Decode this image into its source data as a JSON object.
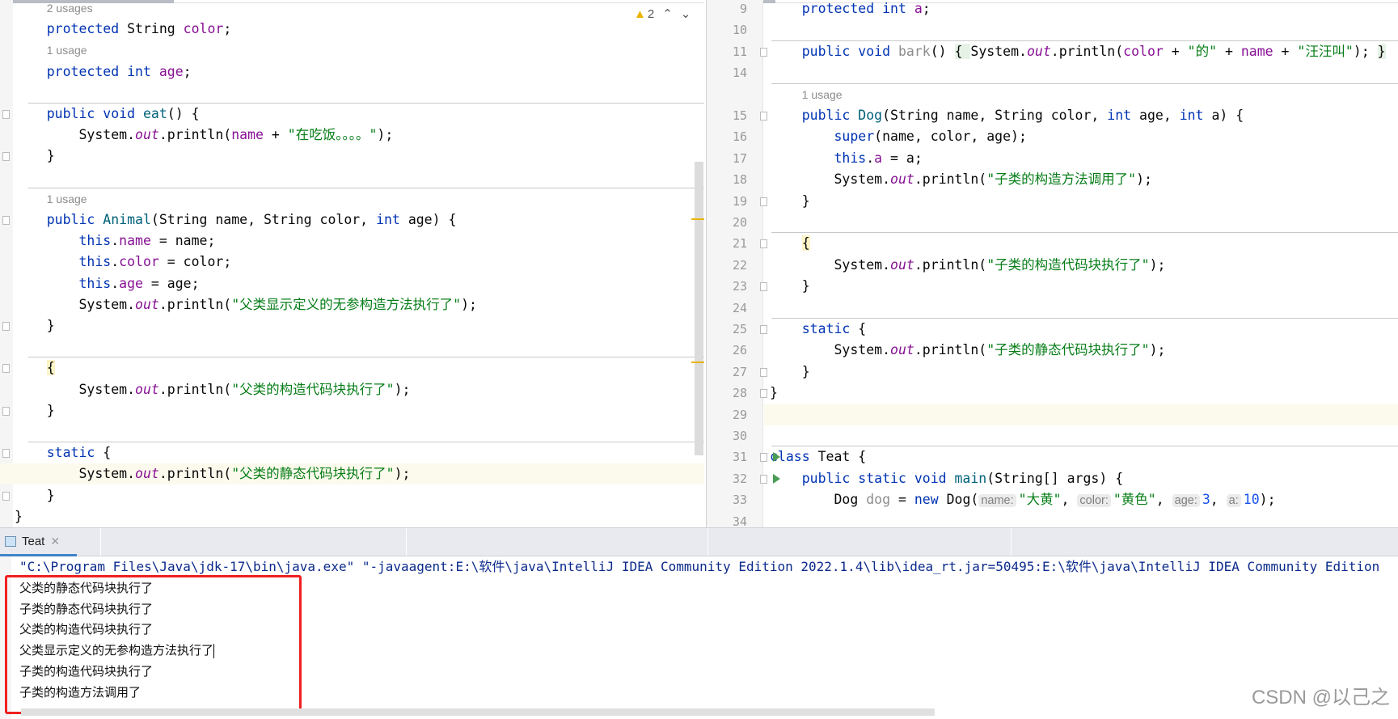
{
  "left_editor": {
    "warning_count": "2",
    "lines": [
      {
        "hint": "2 usages"
      },
      {
        "t": [
          [
            "    "
          ],
          [
            "protected ",
            "kw"
          ],
          [
            "String "
          ],
          [
            "color",
            "fd"
          ],
          [
            ";"
          ]
        ]
      },
      {
        "hint": "1 usage"
      },
      {
        "t": [
          [
            "    "
          ],
          [
            "protected int ",
            "kw"
          ],
          [
            "age",
            "fd"
          ],
          [
            ";"
          ]
        ]
      },
      {
        "t": []
      },
      {
        "t": [
          [
            "    "
          ],
          [
            "public void ",
            "kw"
          ],
          [
            "eat",
            "fn"
          ],
          [
            "() {"
          ]
        ]
      },
      {
        "t": [
          [
            "        System."
          ],
          [
            "out",
            "it"
          ],
          [
            ".println("
          ],
          [
            "name",
            "fd"
          ],
          [
            " + "
          ],
          [
            "\"在吃饭。。。。\"",
            "st"
          ],
          [
            ");"
          ]
        ]
      },
      {
        "t": [
          [
            "    }"
          ]
        ]
      },
      {
        "t": []
      },
      {
        "hint": "1 usage"
      },
      {
        "t": [
          [
            "    "
          ],
          [
            "public ",
            "kw"
          ],
          [
            "Animal",
            "fn"
          ],
          [
            "(String name, String color, "
          ],
          [
            "int ",
            "kw"
          ],
          [
            "age) {"
          ]
        ]
      },
      {
        "t": [
          [
            "        "
          ],
          [
            "this",
            "kw"
          ],
          [
            "."
          ],
          [
            "name",
            "fd"
          ],
          [
            " = name;"
          ]
        ]
      },
      {
        "t": [
          [
            "        "
          ],
          [
            "this",
            "kw"
          ],
          [
            "."
          ],
          [
            "color",
            "fd"
          ],
          [
            " = color;"
          ]
        ]
      },
      {
        "t": [
          [
            "        "
          ],
          [
            "this",
            "kw"
          ],
          [
            "."
          ],
          [
            "age",
            "fd"
          ],
          [
            " = age;"
          ]
        ]
      },
      {
        "t": [
          [
            "        System."
          ],
          [
            "out",
            "it"
          ],
          [
            ".println("
          ],
          [
            "\"父类显示定义的无参构造方法执行了\"",
            "st"
          ],
          [
            ");"
          ]
        ]
      },
      {
        "t": [
          [
            "    }"
          ]
        ]
      },
      {
        "t": []
      },
      {
        "t": [
          [
            "    "
          ],
          [
            "{",
            "mk"
          ]
        ]
      },
      {
        "t": [
          [
            "        System."
          ],
          [
            "out",
            "it"
          ],
          [
            ".println("
          ],
          [
            "\"父类的构造代码块执行了\"",
            "st"
          ],
          [
            ");"
          ]
        ]
      },
      {
        "t": [
          [
            "    }"
          ]
        ]
      },
      {
        "t": []
      },
      {
        "t": [
          [
            "    "
          ],
          [
            "static ",
            "kw"
          ],
          [
            "{"
          ]
        ]
      },
      {
        "t": [
          [
            "        System."
          ],
          [
            "out",
            "it"
          ],
          [
            ".println("
          ],
          [
            "\"父类的静态代码块执行了\"",
            "st"
          ],
          [
            ");"
          ]
        ],
        "current": true
      },
      {
        "t": [
          [
            "    }"
          ]
        ]
      },
      {
        "t": [
          [
            "}"
          ]
        ]
      }
    ]
  },
  "right_editor": {
    "lines": [
      {
        "n": "9",
        "t": [
          [
            "    "
          ],
          [
            "protected int ",
            "kw"
          ],
          [
            "a",
            "fd"
          ],
          [
            ";"
          ]
        ]
      },
      {
        "n": "10",
        "t": []
      },
      {
        "n": "11",
        "t": [
          [
            "    "
          ],
          [
            "public void ",
            "kw"
          ],
          [
            "bark",
            "gr"
          ],
          [
            "() "
          ],
          [
            "{ ",
            "gb"
          ],
          [
            "System."
          ],
          [
            "out",
            "it"
          ],
          [
            ".println("
          ],
          [
            "color",
            "fd"
          ],
          [
            " + "
          ],
          [
            "\"的\"",
            "st"
          ],
          [
            " + "
          ],
          [
            "name",
            "fd"
          ],
          [
            " + "
          ],
          [
            "\"汪汪叫\"",
            "st"
          ],
          [
            "); "
          ],
          [
            "}",
            "gb"
          ]
        ]
      },
      {
        "n": "14",
        "t": []
      },
      {
        "hint": "1 usage"
      },
      {
        "n": "15",
        "t": [
          [
            "    "
          ],
          [
            "public ",
            "kw"
          ],
          [
            "Dog",
            "fn"
          ],
          [
            "(String name, String color, "
          ],
          [
            "int ",
            "kw"
          ],
          [
            "age, "
          ],
          [
            "int ",
            "kw"
          ],
          [
            "a) {"
          ]
        ]
      },
      {
        "n": "16",
        "t": [
          [
            "        "
          ],
          [
            "super",
            "kw"
          ],
          [
            "(name, color, age);"
          ]
        ]
      },
      {
        "n": "17",
        "t": [
          [
            "        "
          ],
          [
            "this",
            "kw"
          ],
          [
            "."
          ],
          [
            "a",
            "fd"
          ],
          [
            " = a;"
          ]
        ]
      },
      {
        "n": "18",
        "t": [
          [
            "        System."
          ],
          [
            "out",
            "it"
          ],
          [
            ".println("
          ],
          [
            "\"子类的构造方法调用了\"",
            "st"
          ],
          [
            ");"
          ]
        ]
      },
      {
        "n": "19",
        "t": [
          [
            "    }"
          ]
        ]
      },
      {
        "n": "20",
        "t": []
      },
      {
        "n": "21",
        "t": [
          [
            "    "
          ],
          [
            "{",
            "mk"
          ]
        ]
      },
      {
        "n": "22",
        "t": [
          [
            "        System."
          ],
          [
            "out",
            "it"
          ],
          [
            ".println("
          ],
          [
            "\"子类的构造代码块执行了\"",
            "st"
          ],
          [
            ");"
          ]
        ]
      },
      {
        "n": "23",
        "t": [
          [
            "    }"
          ]
        ]
      },
      {
        "n": "24",
        "t": []
      },
      {
        "n": "25",
        "t": [
          [
            "    "
          ],
          [
            "static ",
            "kw"
          ],
          [
            "{"
          ]
        ]
      },
      {
        "n": "26",
        "t": [
          [
            "        System."
          ],
          [
            "out",
            "it"
          ],
          [
            ".println("
          ],
          [
            "\"子类的静态代码块执行了\"",
            "st"
          ],
          [
            ");"
          ]
        ]
      },
      {
        "n": "27",
        "t": [
          [
            "    }"
          ]
        ]
      },
      {
        "n": "28",
        "t": [
          [
            "}"
          ]
        ]
      },
      {
        "n": "29",
        "t": [],
        "current": true
      },
      {
        "n": "30",
        "t": []
      },
      {
        "n": "31",
        "run": true,
        "t": [
          [
            "class ",
            "kw"
          ],
          [
            "Teat {"
          ]
        ]
      },
      {
        "n": "32",
        "run": true,
        "t": [
          [
            "    "
          ],
          [
            "public static void ",
            "kw"
          ],
          [
            "main",
            "fn"
          ],
          [
            "(String[] args) {"
          ]
        ]
      },
      {
        "n": "33",
        "t": [
          [
            "        Dog "
          ],
          [
            "dog ",
            "gr"
          ],
          [
            "= "
          ],
          [
            "new ",
            "kw"
          ],
          [
            "Dog("
          ],
          [
            "name:",
            "ph"
          ],
          [
            "\"大黄\"",
            "st"
          ],
          [
            ", "
          ],
          [
            "color:",
            "ph"
          ],
          [
            "\"黄色\"",
            "st"
          ],
          [
            ", "
          ],
          [
            "age:",
            "ph"
          ],
          [
            "3",
            "nm"
          ],
          [
            ", "
          ],
          [
            "a:",
            "ph"
          ],
          [
            "10",
            "nm"
          ],
          [
            ");"
          ]
        ]
      },
      {
        "n": "34",
        "t": []
      }
    ]
  },
  "run_panel": {
    "tab_label": "Teat",
    "command": "\"C:\\Program Files\\Java\\jdk-17\\bin\\java.exe\" \"-javaagent:E:\\软件\\java\\IntelliJ IDEA Community Edition 2022.1.4\\lib\\idea_rt.jar=50495:E:\\软件\\java\\IntelliJ IDEA Community Edition",
    "output": [
      "父类的静态代码块执行了",
      "子类的静态代码块执行了",
      "父类的构造代码块执行了",
      "父类显示定义的无参构造方法执行了",
      "子类的构造代码块执行了",
      "子类的构造方法调用了"
    ]
  },
  "watermark": "CSDN @以己之",
  "colors": {
    "keyword": "#0033b3",
    "field": "#871094",
    "string": "#067d17",
    "highlight_box": "#f02020",
    "run_icon": "#499c54"
  }
}
